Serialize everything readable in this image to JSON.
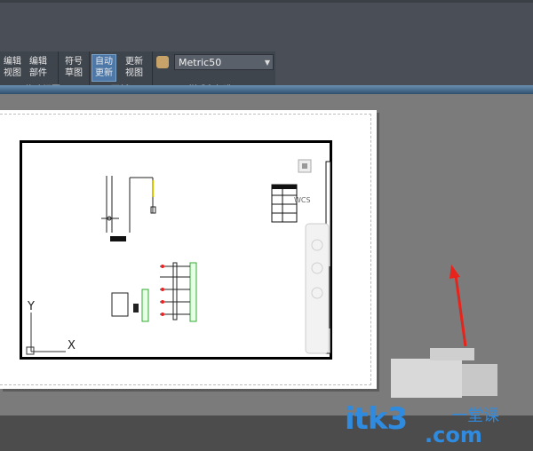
{
  "ribbon": {
    "groups": [
      {
        "name": "modify-view",
        "label": "修改视图",
        "buttons": [
          {
            "line1": "编辑",
            "line2": "视图"
          },
          {
            "line1": "编辑",
            "line2": "部件"
          }
        ]
      },
      {
        "name": "update",
        "label": "更新",
        "buttons": [
          {
            "line1": "符号",
            "line2": "草图"
          },
          {
            "line1": "自动",
            "line2": "更新"
          },
          {
            "line1": "更新",
            "line2": "视图"
          }
        ]
      },
      {
        "name": "styles",
        "label": "样式和标准"
      }
    ],
    "style_dropdown": {
      "value": "Metric50"
    }
  },
  "drawing": {
    "ucs_y": "Y",
    "ucs_x": "X",
    "wcs_label": "WCS"
  },
  "watermark": {
    "brand": "itk3",
    "domain": ".com",
    "tagline": "一堂课"
  },
  "colors": {
    "accent_blue": "#4d78a8",
    "annotation_arrow": "#e8231b",
    "watermark": "#2f8be0"
  }
}
